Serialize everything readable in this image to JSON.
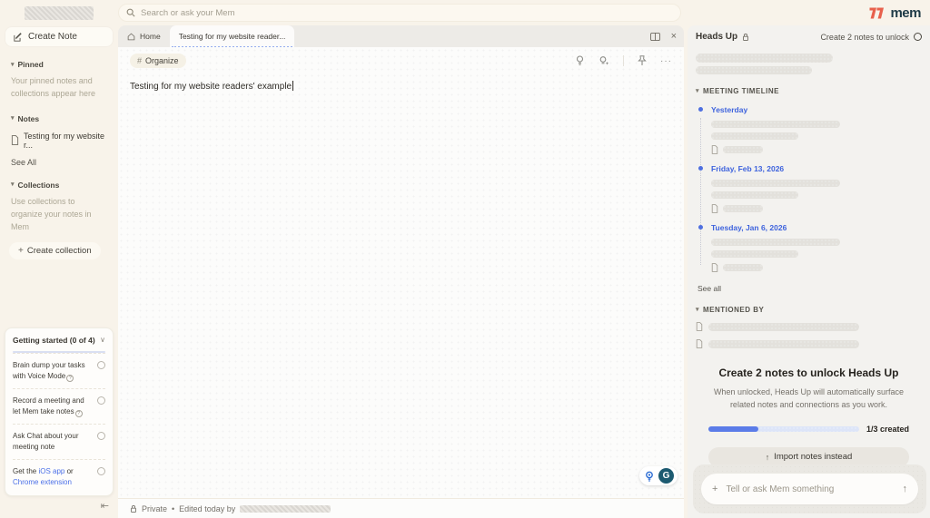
{
  "colors": {
    "brand_coral": "#E8604C",
    "logo_navy": "#1E3A46",
    "accent_blue": "#3E63DD",
    "progress_blue": "#5B7CE8"
  },
  "icons": {
    "plus": "+",
    "send_arrow": "↑",
    "import_arrow": "↑",
    "collapse": "⇤",
    "close": "×",
    "ellipsis": "···",
    "chevron_down": "▾",
    "chevron_collapse": "∨",
    "hash": "#",
    "help": "?"
  },
  "topbar": {
    "search_placeholder": "Search or ask your Mem",
    "logo_text": "mem"
  },
  "sidebar": {
    "create_note_label": "Create Note",
    "pinned_label": "Pinned",
    "pinned_empty": "Your pinned notes and collections appear here",
    "notes_label": "Notes",
    "note_item_title": "Testing for my website r...",
    "see_all_label": "See All",
    "collections_label": "Collections",
    "collections_empty": "Use collections to organize your notes in Mem",
    "create_collection_label": "Create collection",
    "getting_started": {
      "title": "Getting started (0 of 4)",
      "items": [
        {
          "label": "Brain dump your tasks with Voice Mode"
        },
        {
          "label": "Record a meeting and let Mem take notes"
        },
        {
          "label": "Ask Chat about your meeting note"
        },
        {
          "prefix": "Get the ",
          "ios_link": "iOS app",
          "middle": " or ",
          "chrome_link": "Chrome extension"
        }
      ]
    }
  },
  "editor": {
    "tab_home": "Home",
    "tab_note": "Testing for my website reader...",
    "organize_label": "Organize",
    "body_text": "Testing for my website readers' example",
    "status_privacy": "Private",
    "status_separator": "•",
    "status_edited": "Edited today by",
    "grammarly_letter": "G"
  },
  "heads_up": {
    "title": "Heads Up",
    "unlock_hint": "Create 2 notes to unlock",
    "timeline_label": "MEETING TIMELINE",
    "timeline_entries": [
      {
        "date": "Yesterday"
      },
      {
        "date": "Friday, Feb 13, 2026"
      },
      {
        "date": "Tuesday, Jan 6, 2026"
      }
    ],
    "see_all_label": "See all",
    "mentioned_label": "MENTIONED BY",
    "unlock_card": {
      "heading": "Create 2 notes to unlock Heads Up",
      "description": "When unlocked, Heads Up will automatically surface related notes and connections as you work.",
      "progress_label": "1/3 created",
      "progress_pct": 33,
      "import_label": "Import notes instead"
    },
    "chat_placeholder": "Tell or ask Mem something"
  }
}
